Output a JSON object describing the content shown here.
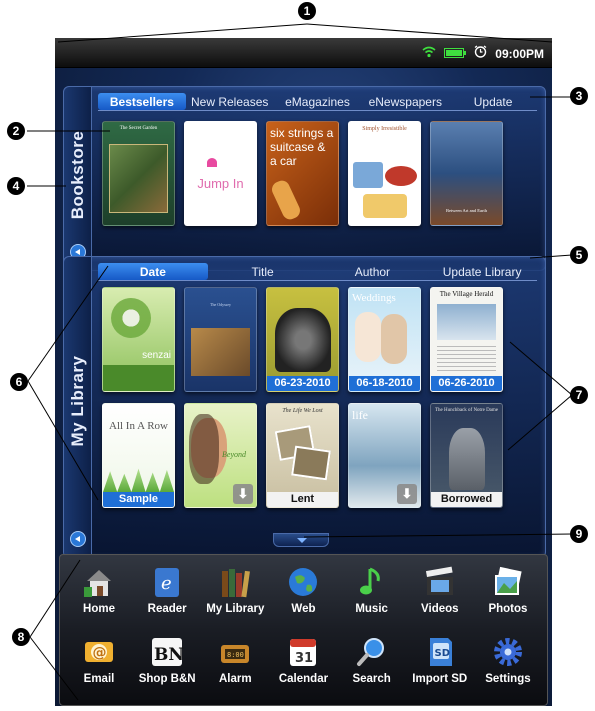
{
  "status_bar": {
    "clock": "09:00PM",
    "icons": [
      "wifi-icon",
      "battery-icon",
      "alarm-clock-icon"
    ]
  },
  "bookstore": {
    "label": "Bookstore",
    "tabs": [
      "Bestsellers",
      "New Releases",
      "eMagazines",
      "eNewspapers",
      "Update"
    ],
    "active_tab": "Bestsellers",
    "covers": [
      {
        "title": "The Secret Garden",
        "color": "#2b5a3a"
      },
      {
        "title": "Jump In",
        "color": "#ffffff"
      },
      {
        "title": "six strings a suitcase & a car",
        "color": "#b04a12"
      },
      {
        "title": "Simply Irresistible",
        "color": "#ffffff"
      },
      {
        "title": "Between Art and Earth",
        "color": "#3a5f8c"
      }
    ]
  },
  "library": {
    "label": "My Library",
    "tabs": [
      "Date",
      "Title",
      "Author",
      "Update Library"
    ],
    "active_tab": "Date",
    "row1": [
      {
        "title": "senzai",
        "tag": ""
      },
      {
        "title": "The Odyssey",
        "tag": ""
      },
      {
        "title": "",
        "tag": "06-23-2010"
      },
      {
        "title": "Weddings",
        "tag": "06-18-2010"
      },
      {
        "title": "The Village Herald",
        "tag": "06-26-2010"
      }
    ],
    "row2": [
      {
        "title": "All In A Row",
        "tag": "Sample",
        "tag_style": "blue"
      },
      {
        "title": "Beyond",
        "tag": ""
      },
      {
        "title": "The Life We Lost",
        "tag": "Lent",
        "tag_style": "white"
      },
      {
        "title": "life",
        "tag": ""
      },
      {
        "title": "The Hunchback of Notre Dame",
        "tag": "Borrowed",
        "tag_style": "white"
      }
    ]
  },
  "dock": {
    "row1": [
      "Home",
      "Reader",
      "My Library",
      "Web",
      "Music",
      "Videos",
      "Photos"
    ],
    "row2": [
      "Email",
      "Shop B&N",
      "Alarm",
      "Calendar",
      "Search",
      "Import SD",
      "Settings"
    ],
    "icon_text": {
      "reader": "e",
      "shop": "BN",
      "calendar": "31",
      "import": "SD",
      "email": "@"
    }
  },
  "callouts": [
    "1",
    "2",
    "3",
    "4",
    "5",
    "6",
    "7",
    "8",
    "9"
  ]
}
